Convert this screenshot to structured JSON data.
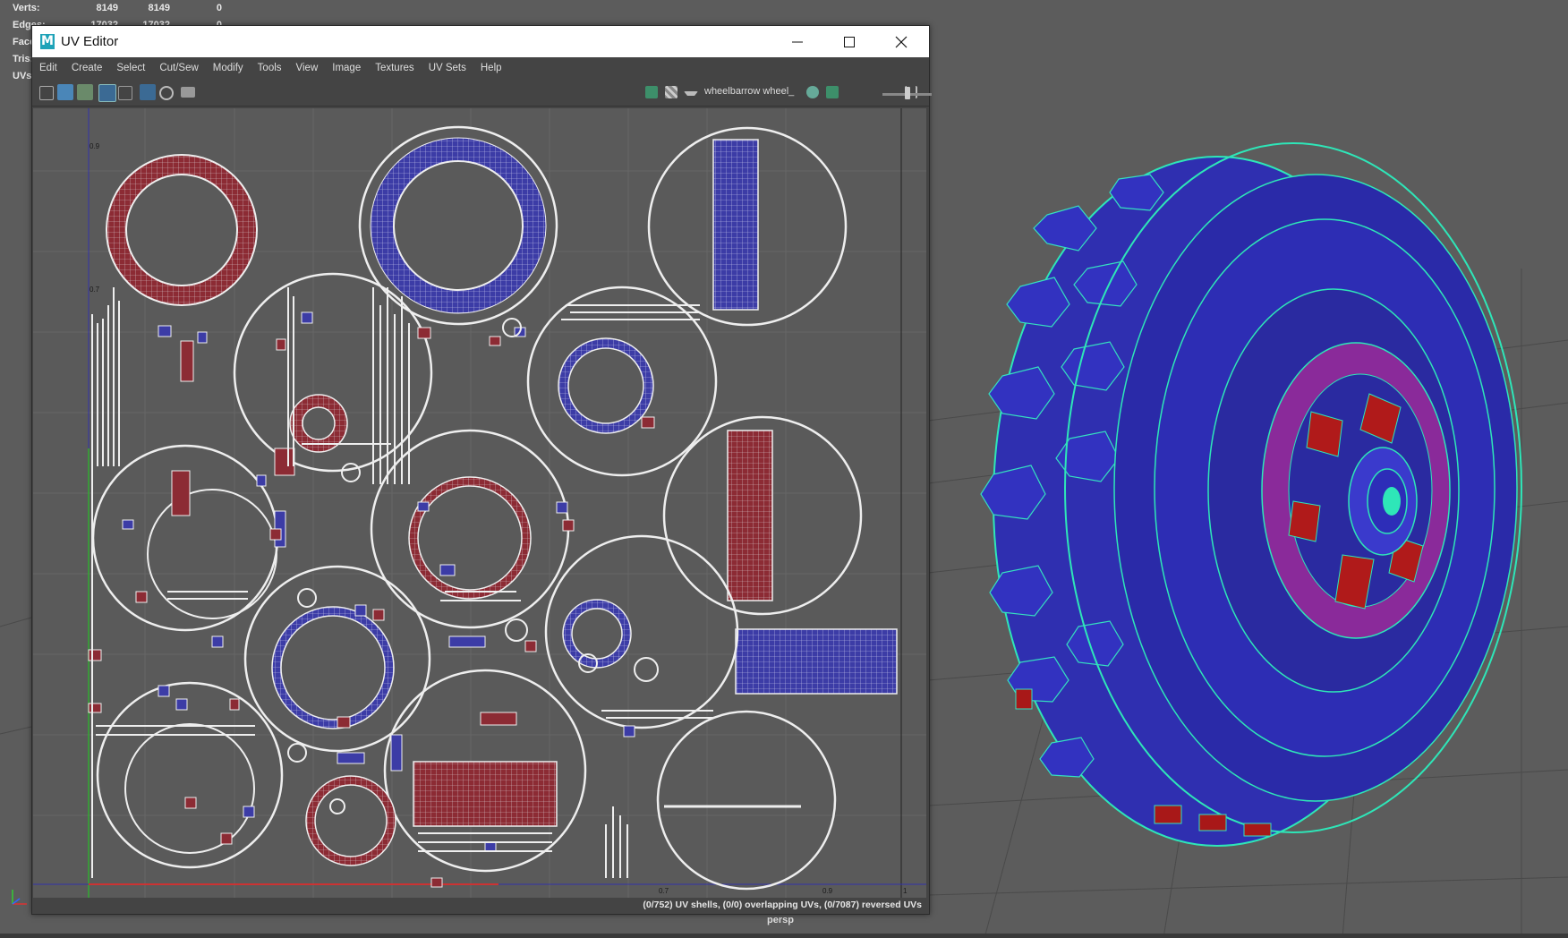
{
  "hud": {
    "rows": [
      {
        "label": "Verts:",
        "v1": "8149",
        "v2": "8149",
        "v3": "0"
      },
      {
        "label": "Edges:",
        "v1": "17032",
        "v2": "17032",
        "v3": "0"
      },
      {
        "label": "Faces:"
      },
      {
        "label": "Tris:"
      },
      {
        "label": "UVs:"
      }
    ]
  },
  "viewport": {
    "camera_label": "persp"
  },
  "uv_editor": {
    "title": "UV Editor",
    "menu": [
      "Edit",
      "Create",
      "Select",
      "Cut/Sew",
      "Modify",
      "Tools",
      "View",
      "Image",
      "Textures",
      "UV Sets",
      "Help"
    ],
    "texture_name": "wheelbarrow wheel_",
    "status": "(0/752) UV shells, (0/0) overlapping UVs, (0/7087) reversed UVs",
    "ticks": {
      "v09": "0.9",
      "v07": "0.7",
      "u07": "0.7",
      "u09": "0.9",
      "u1": "1"
    }
  },
  "icons": [
    "maya-icon",
    "minimize-icon",
    "maximize-icon",
    "close-icon",
    "toolbar-icons",
    "texture-icon",
    "checker-icon",
    "dropdown-icon"
  ]
}
